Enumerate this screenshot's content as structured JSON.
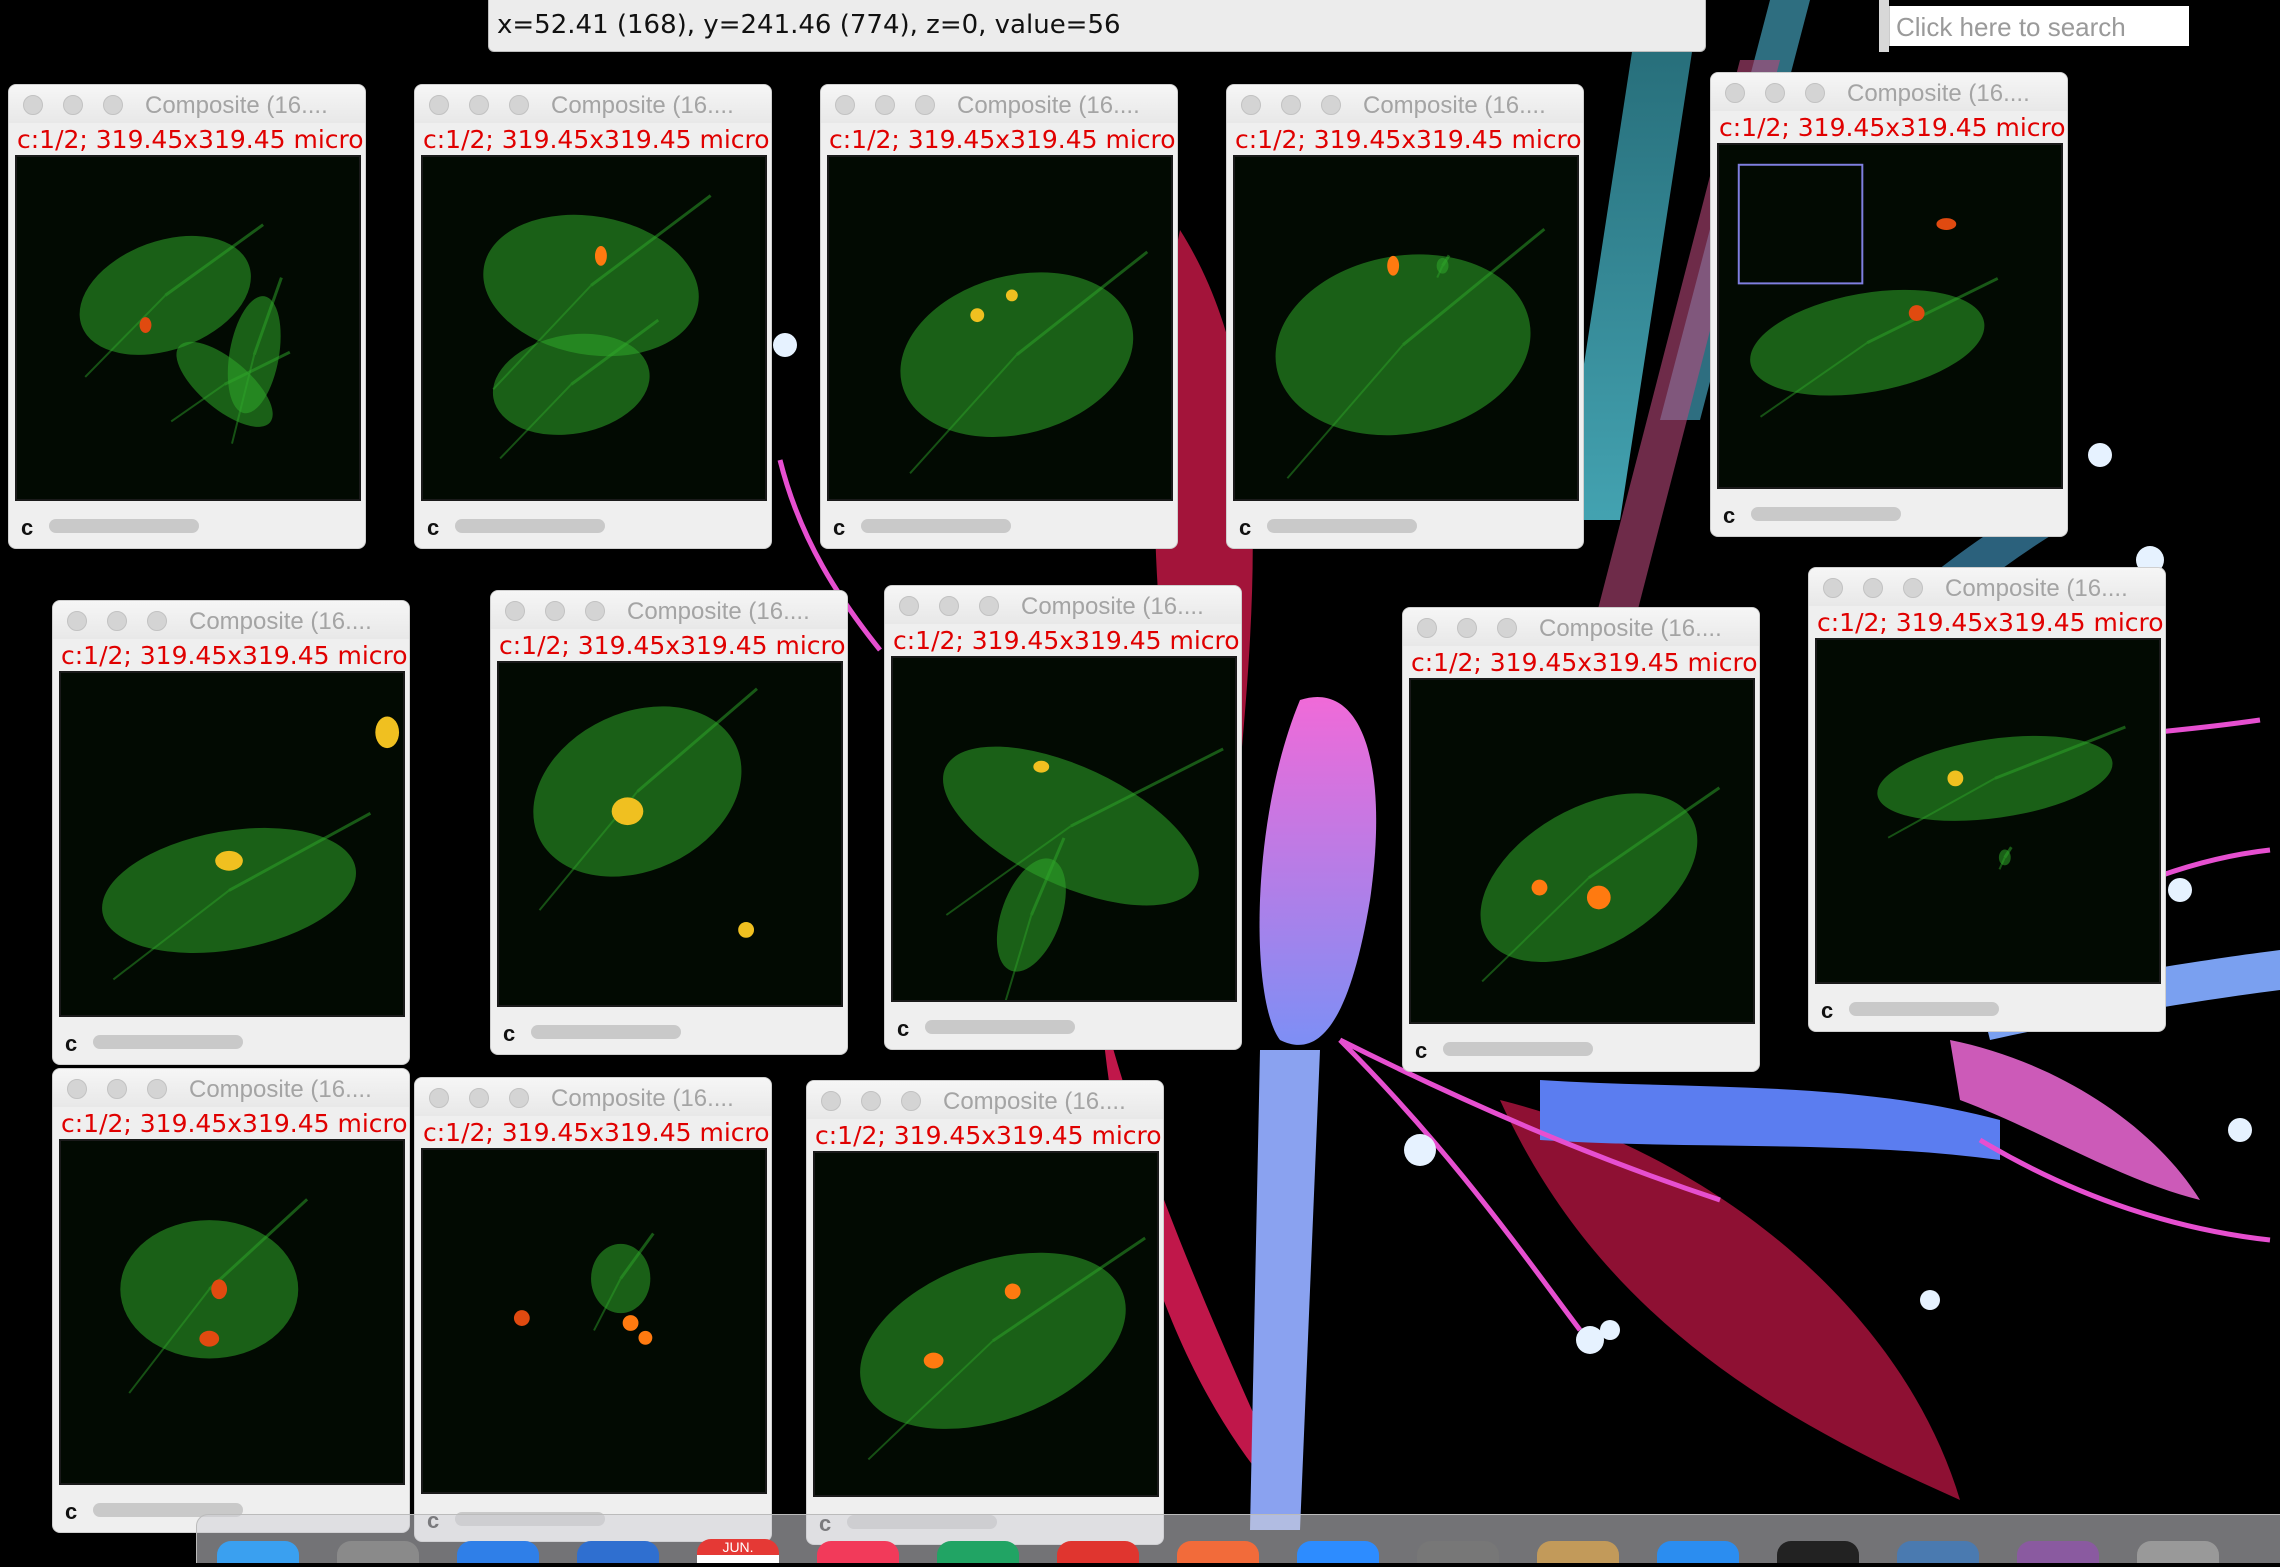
{
  "status_bar": {
    "coordinates": "x=52.41 (168), y=241.46 (774), z=0, value=56",
    "search_placeholder": "Click here to search"
  },
  "windows": [
    {
      "title": "Composite (16....",
      "subtitle": "c:1/2; 319.45x319.45 micro",
      "channel_label": "c"
    },
    {
      "title": "Composite (16....",
      "subtitle": "c:1/2; 319.45x319.45 micro",
      "channel_label": "c"
    },
    {
      "title": "Composite (16....",
      "subtitle": "c:1/2; 319.45x319.45 micro",
      "channel_label": "c"
    },
    {
      "title": "Composite (16....",
      "subtitle": "c:1/2; 319.45x319.45 micro",
      "channel_label": "c"
    },
    {
      "title": "Composite (16....",
      "subtitle": "c:1/2; 319.45x319.45 micro",
      "channel_label": "c"
    },
    {
      "title": "Composite (16....",
      "subtitle": "c:1/2; 319.45x319.45 micro",
      "channel_label": "c"
    },
    {
      "title": "Composite (16....",
      "subtitle": "c:1/2; 319.45x319.45 micro",
      "channel_label": "c"
    },
    {
      "title": "Composite (16....",
      "subtitle": "c:1/2; 319.45x319.45 micro",
      "channel_label": "c"
    },
    {
      "title": "Composite (16....",
      "subtitle": "c:1/2; 319.45x319.45 micro",
      "channel_label": "c"
    },
    {
      "title": "Composite (16....",
      "subtitle": "c:1/2; 319.45x319.45 micro",
      "channel_label": "c"
    },
    {
      "title": "Composite (16....",
      "subtitle": "c:1/2; 319.45x319.45 micro",
      "channel_label": "c"
    },
    {
      "title": "Composite (16....",
      "subtitle": "c:1/2; 319.45x319.45 micro",
      "channel_label": "c"
    },
    {
      "title": "Composite (16....",
      "subtitle": "c:1/2; 319.45x319.45 micro",
      "channel_label": "c"
    }
  ],
  "dock": {
    "calendar_month": "JUN.",
    "icons": [
      "finder-icon",
      "launchpad-icon",
      "safari-icon",
      "vscode-icon",
      "calendar-icon",
      "music-icon",
      "sheets-icon",
      "app-red-icon",
      "app-orange-icon",
      "zoom-icon",
      "downloads-icon",
      "preview-icon",
      "app-blue-icon",
      "terminal-icon",
      "window-icon",
      "photo-icon",
      "trash-icon"
    ]
  },
  "colors": {
    "subtitle_red": "#e00000",
    "cell_green": "#2fa82a",
    "cell_red": "#e04a10",
    "cell_yellow": "#f0c020"
  }
}
